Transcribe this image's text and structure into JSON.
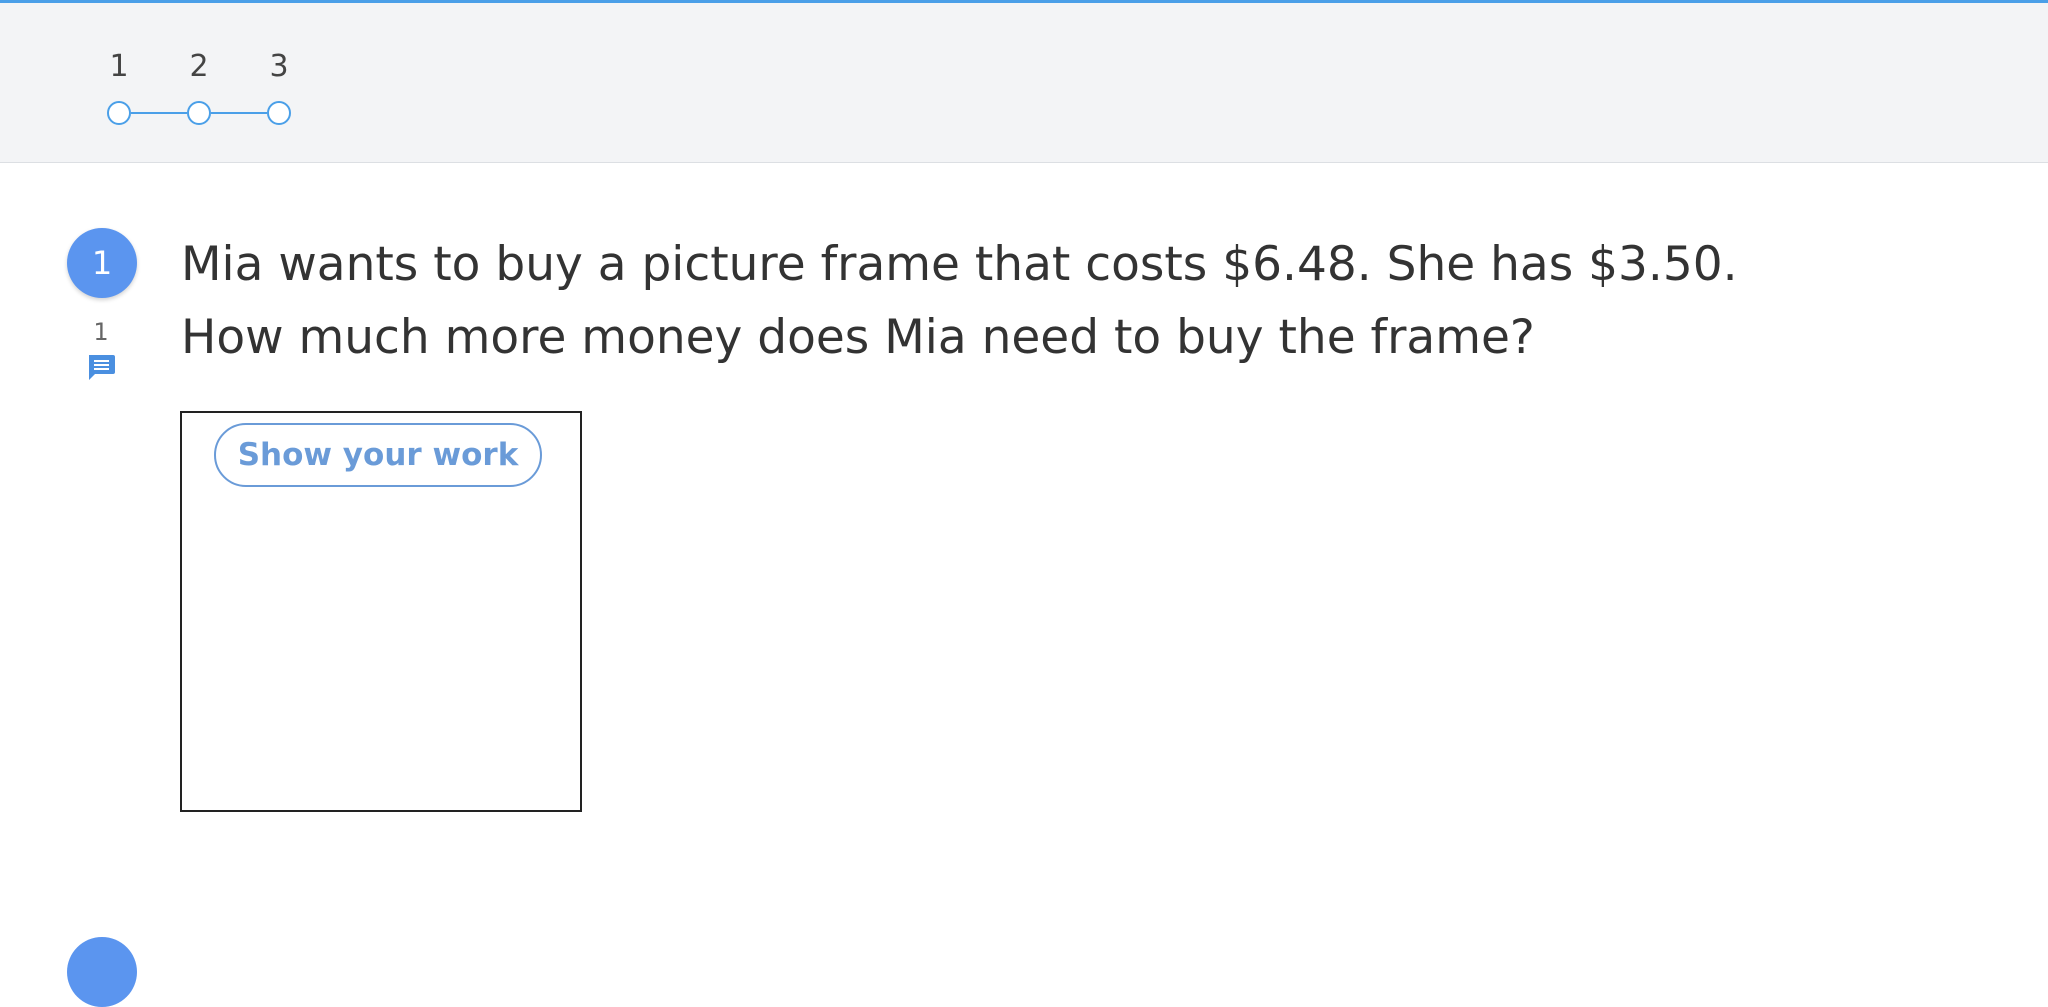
{
  "stepper": {
    "steps": [
      {
        "label": "1"
      },
      {
        "label": "2"
      },
      {
        "label": "3"
      }
    ]
  },
  "question": {
    "number": "1",
    "comment_count": "1",
    "line1": "Mia wants to buy a picture frame that costs $6.48. She has $3.50.",
    "line2": "How much more money does Mia need to buy the frame?",
    "show_work_label": "Show your work"
  },
  "colors": {
    "accent": "#4a9fe8",
    "badge": "#5b95ef",
    "button_text": "#6a9bd8",
    "stepper_background": "#f3f4f6"
  }
}
